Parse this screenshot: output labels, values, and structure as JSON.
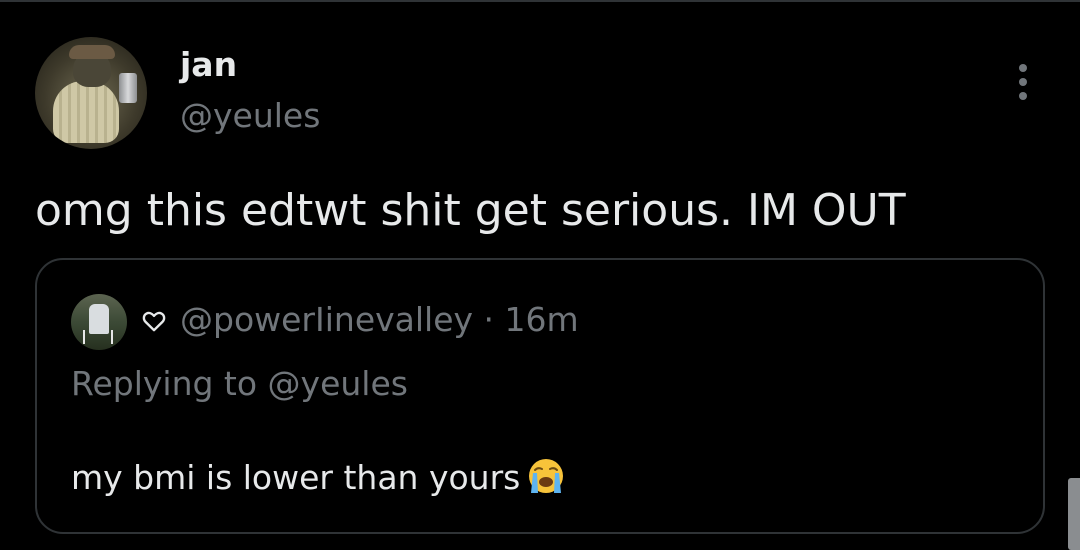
{
  "tweet": {
    "author": {
      "display_name": "jan",
      "handle": "@yeules"
    },
    "text": "omg this edtwt shit get serious. IM OUT",
    "more_icon": "more-vertical-icon"
  },
  "quoted_tweet": {
    "handle": "@powerIinevalley",
    "separator": "·",
    "time": "16m",
    "replying_to": "Replying to @yeules",
    "text": "my bmi is lower than yours",
    "name_icon": "heart-icon",
    "emoji": "loudly-crying-face-emoji"
  },
  "colors": {
    "background": "#000000",
    "text_primary": "#e7e9ea",
    "text_secondary": "#71767b",
    "border": "#2f3336"
  }
}
